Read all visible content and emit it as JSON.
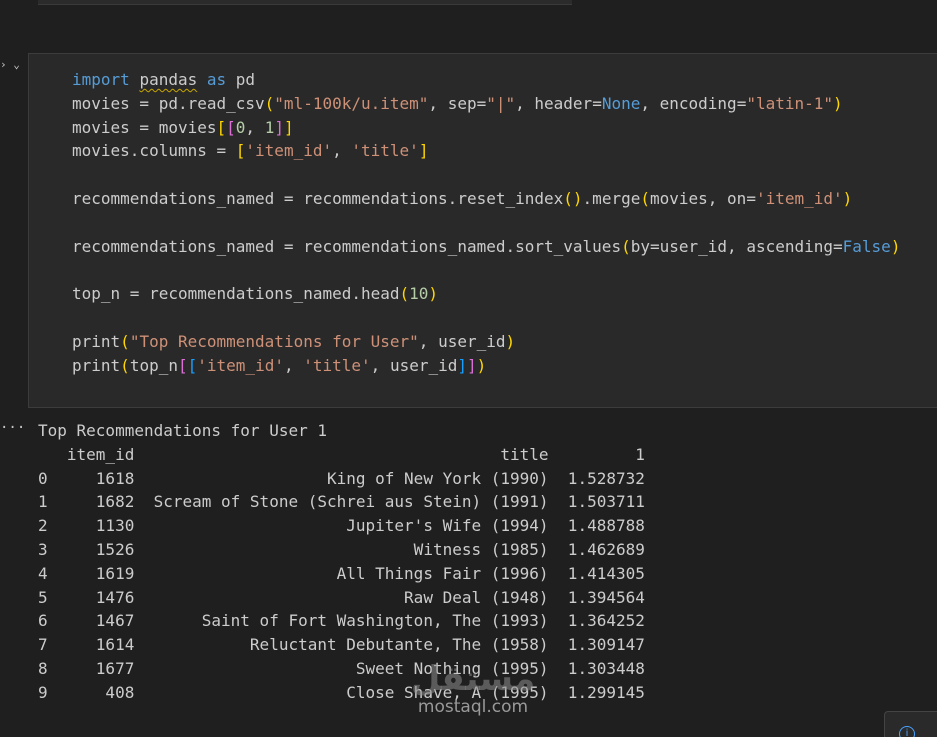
{
  "cell": {
    "toolbar_glyphs": "› ⌄",
    "code_lines": [
      "import pandas as pd",
      "movies = pd.read_csv(\"ml-100k/u.item\", sep=\"|\", header=None, encoding=\"latin-1\")",
      "movies = movies[[0, 1]]",
      "movies.columns = ['item_id', 'title']",
      "",
      "recommendations_named = recommendations.reset_index().merge(movies, on='item_id')",
      "",
      "recommendations_named = recommendations_named.sort_values(by=user_id, ascending=False)",
      "",
      "top_n = recommendations_named.head(10)",
      "",
      "print(\"Top Recommendations for User\", user_id)",
      "print(top_n[['item_id', 'title', user_id]])"
    ]
  },
  "output": {
    "ellipsis": "···",
    "heading": "Top Recommendations for User 1",
    "columns": [
      "item_id",
      "title",
      "1"
    ],
    "rows": [
      {
        "index": "0",
        "item_id": "1618",
        "title": "King of New York (1990)",
        "value": "1.528732"
      },
      {
        "index": "1",
        "item_id": "1682",
        "title": "Scream of Stone (Schrei aus Stein) (1991)",
        "value": "1.503711"
      },
      {
        "index": "2",
        "item_id": "1130",
        "title": "Jupiter's Wife (1994)",
        "value": "1.488788"
      },
      {
        "index": "3",
        "item_id": "1526",
        "title": "Witness (1985)",
        "value": "1.462689"
      },
      {
        "index": "4",
        "item_id": "1619",
        "title": "All Things Fair (1996)",
        "value": "1.414305"
      },
      {
        "index": "5",
        "item_id": "1476",
        "title": "Raw Deal (1948)",
        "value": "1.394564"
      },
      {
        "index": "6",
        "item_id": "1467",
        "title": "Saint of Fort Washington, The (1993)",
        "value": "1.364252"
      },
      {
        "index": "7",
        "item_id": "1614",
        "title": "Reluctant Debutante, The (1958)",
        "value": "1.309147"
      },
      {
        "index": "8",
        "item_id": "1677",
        "title": "Sweet Nothing (1995)",
        "value": "1.303448"
      },
      {
        "index": "9",
        "item_id": "408",
        "title": "Close Shave, A (1995)",
        "value": "1.299145"
      }
    ]
  },
  "watermark": {
    "arabic": "مستقل",
    "url": "mostaql.com"
  },
  "notification": {
    "icon": "info-icon",
    "glyph": "i"
  },
  "colors": {
    "background": "#1f1f1f",
    "cell_background": "#292929",
    "keyword": "#569cd6",
    "string": "#ce9178",
    "number": "#b5cea8",
    "bracket_level1": "#ffd700",
    "bracket_level2": "#da70d6",
    "bracket_level3": "#179fff",
    "text": "#cccccc"
  }
}
